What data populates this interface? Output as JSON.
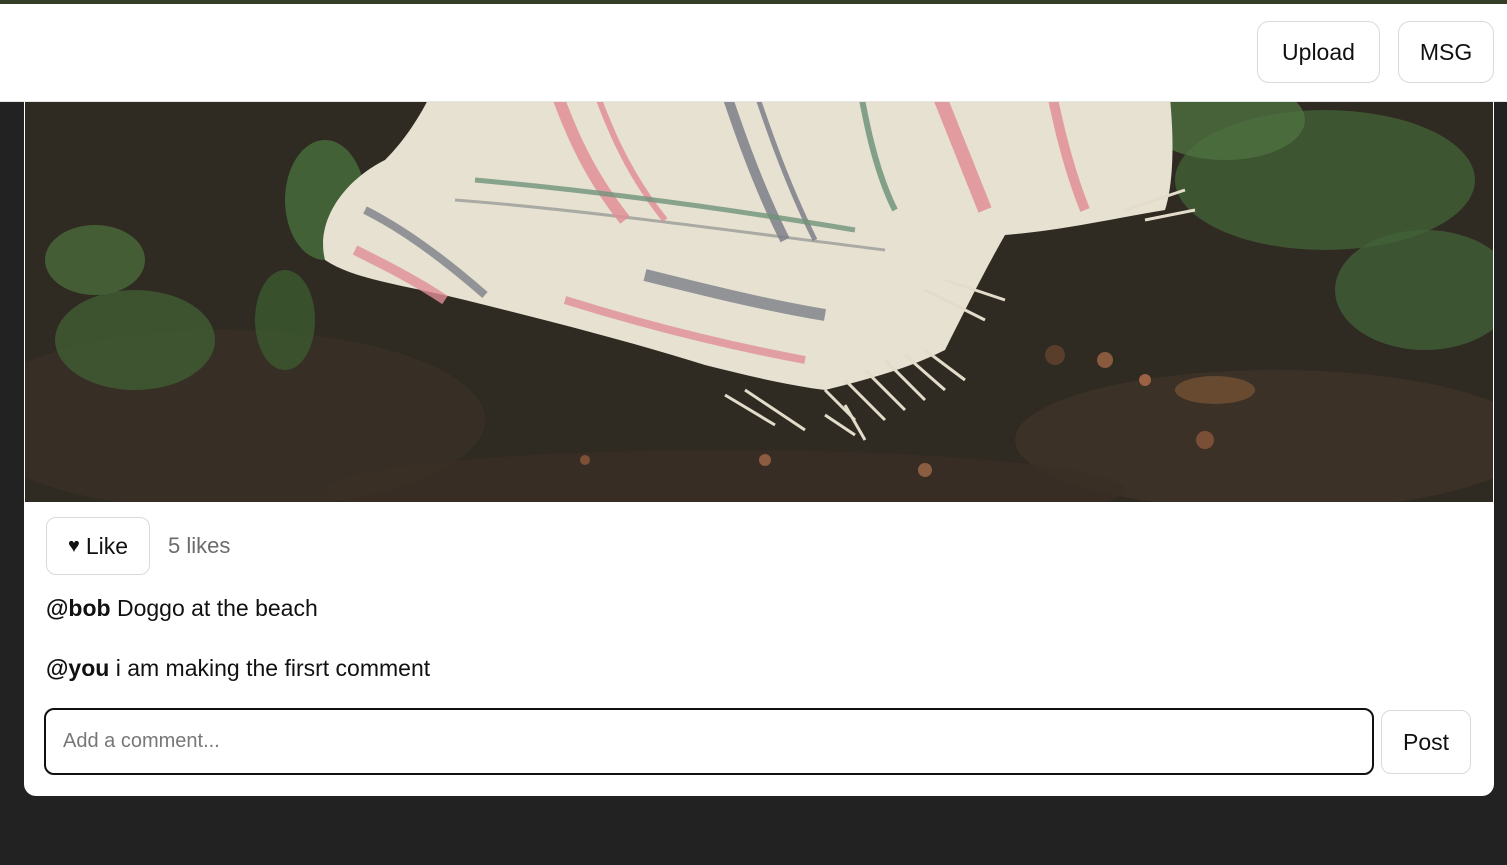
{
  "header": {
    "upload_label": "Upload",
    "msg_label": "MSG"
  },
  "post": {
    "image_alt_icon": "photo-blanket-on-forest-floor",
    "like_label": "Like",
    "like_icon": "heart-icon",
    "likes_text": "5 likes",
    "comments": [
      {
        "user": "@bob",
        "text": "Doggo at the beach"
      },
      {
        "user": "@you",
        "text": "i am making the firsrt comment"
      }
    ],
    "comment_placeholder": "Add a comment...",
    "post_label": "Post"
  },
  "colors": {
    "background": "#222222",
    "accent_strip": "#343d26",
    "card": "#ffffff"
  }
}
